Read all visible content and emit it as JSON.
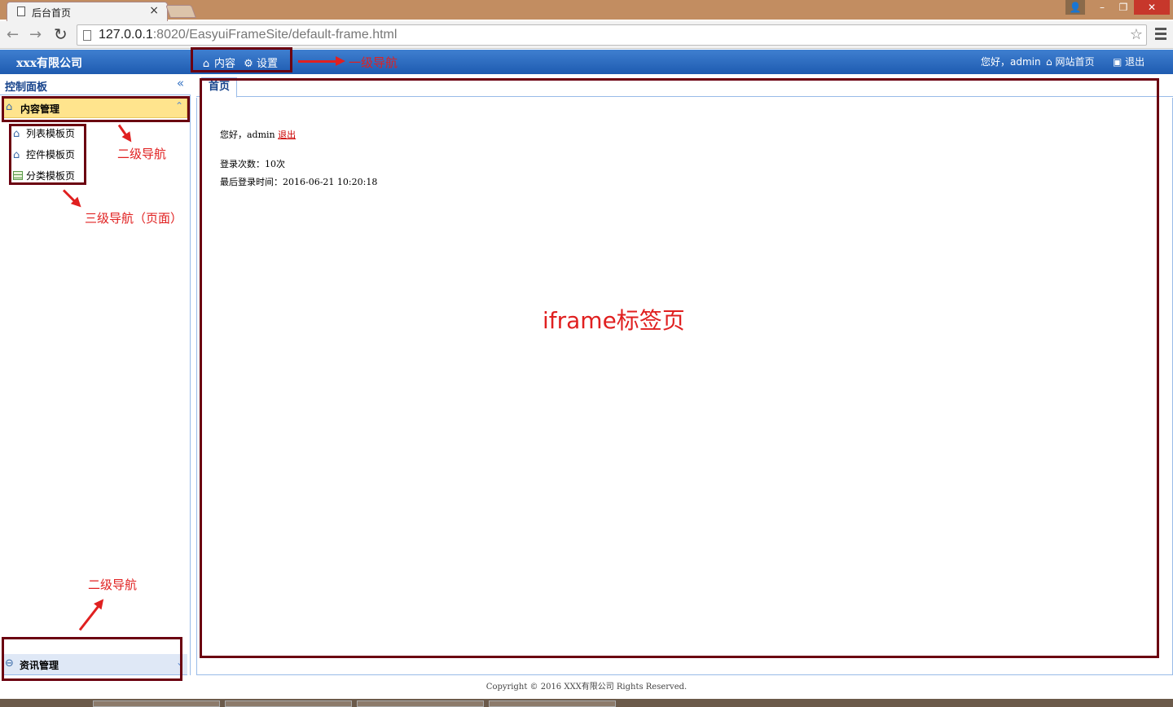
{
  "browser": {
    "tab_title": "后台首页",
    "tab_close": "×",
    "url_host": "127.0.0.1",
    "url_rest": ":8020/EasyuiFrameSite/default-frame.html",
    "back_icon": "←",
    "forward_icon": "→",
    "reload_icon": "↻",
    "star_icon": "☆",
    "win_user": "👤",
    "win_min": "–",
    "win_max": "❐",
    "win_close": "✕"
  },
  "header": {
    "company": "xxx有限公司",
    "topnav": [
      {
        "icon": "⌂",
        "label": "内容"
      },
      {
        "icon": "⚙",
        "label": "设置"
      }
    ],
    "greeting": "您好，admin",
    "site_home": "网站首页",
    "logout": "退出",
    "home_icon": "⌂",
    "logout_icon": "▣"
  },
  "west": {
    "title": "控制面板",
    "collapse_icon": "«",
    "panels": [
      {
        "label": "内容管理",
        "icon": "⌂",
        "toggle": "⌃"
      },
      {
        "label": "资讯管理",
        "icon": "⊖",
        "toggle": "⌄"
      }
    ],
    "tree": [
      {
        "label": "列表模板页",
        "icon": "⌂"
      },
      {
        "label": "控件模板页",
        "icon": "⌂"
      },
      {
        "label": "分类模板页",
        "icon": "grid"
      }
    ]
  },
  "center": {
    "tab": "首页",
    "welcome_prefix": "您好，admin ",
    "welcome_logout": "退出",
    "login_count": "登录次数：10次",
    "last_login": "最后登录时间：2016-06-21 10:20:18"
  },
  "footer": "Copyright © 2016 XXX有限公司 Rights Reserved.",
  "annotations": {
    "level1": "一级导航",
    "level2_top": "二级导航",
    "level3": "三级导航（页面）",
    "level2_bottom": "二级导航",
    "iframe": "iframe标签页"
  },
  "colors": {
    "header_blue": "#1e5bb0",
    "annotation_red": "#e02020",
    "box_border": "#6b0010",
    "active_panel": "#ffe48d"
  }
}
